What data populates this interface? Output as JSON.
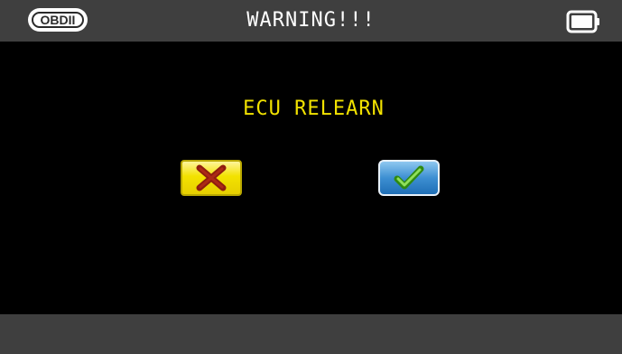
{
  "header": {
    "badge_label": "OBDII",
    "title": "WARNING!!!",
    "battery_icon": "battery-icon"
  },
  "dialog": {
    "prompt": "ECU RELEARN",
    "cancel_icon": "cross-icon",
    "confirm_icon": "checkmark-icon"
  },
  "colors": {
    "bar_bg": "#3f3f3f",
    "screen_bg": "#000000",
    "prompt_text": "#f2e200",
    "title_text": "#ffffff"
  }
}
